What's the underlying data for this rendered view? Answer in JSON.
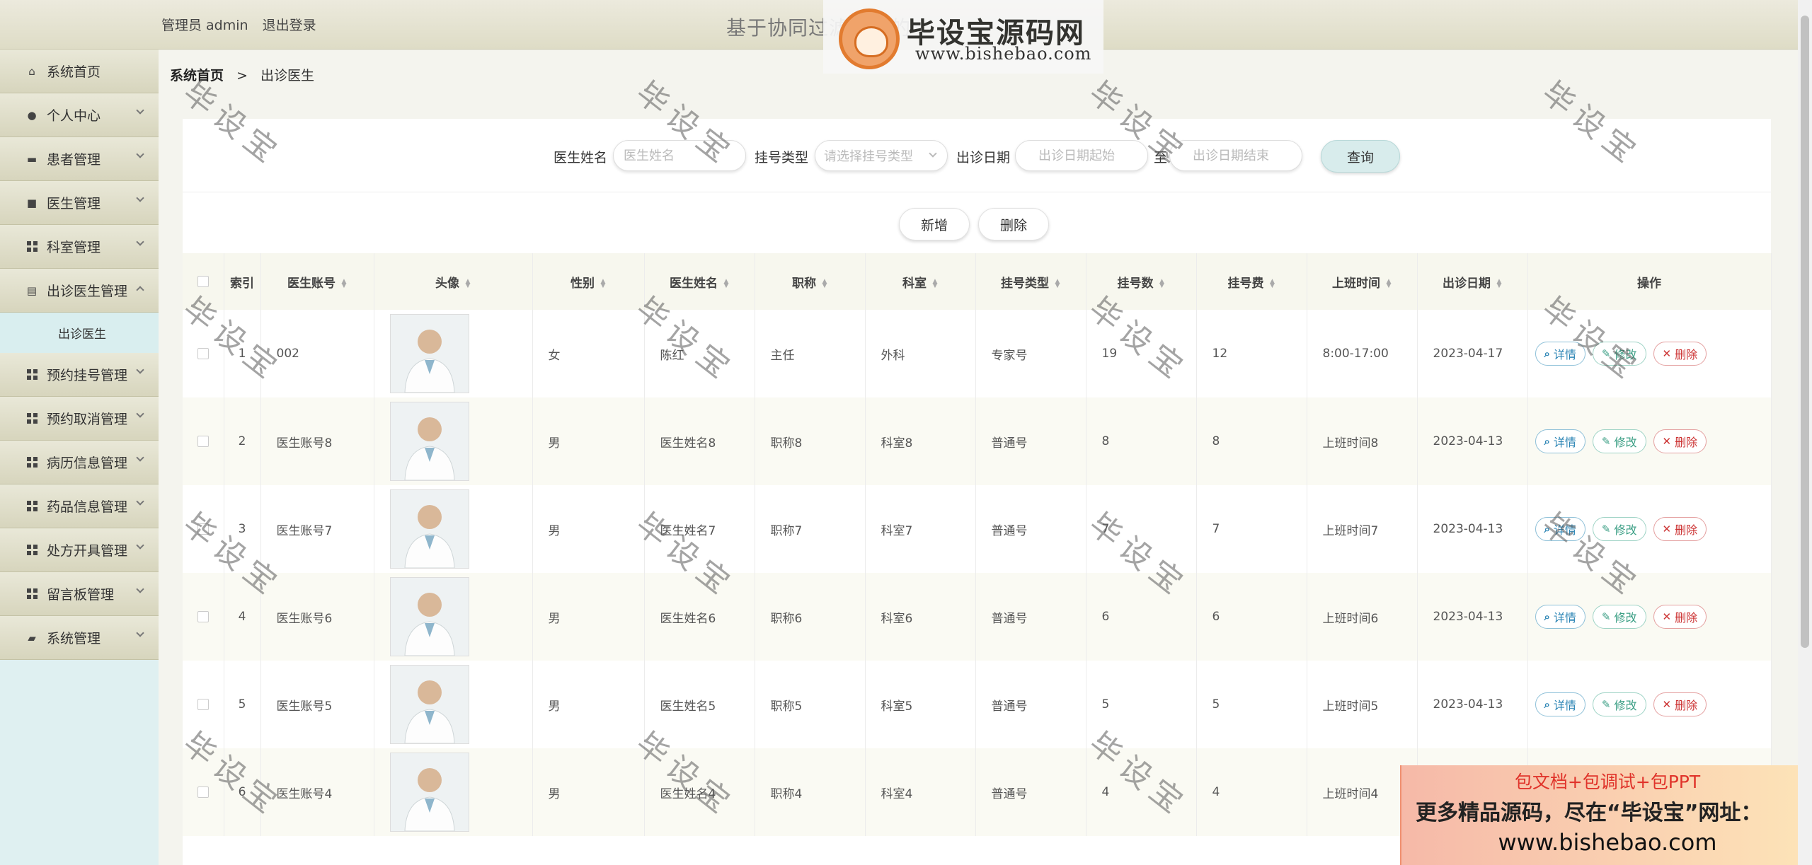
{
  "header": {
    "user_role": "管理员 admin",
    "logout": "退出登录",
    "system_title": "基于协同过滤算法的"
  },
  "logo": {
    "name": "毕设宝源码网",
    "url": "www.bishebao.com"
  },
  "sidebar": {
    "items": [
      {
        "label": "系统首页",
        "icon": "home-icon"
      },
      {
        "label": "个人中心",
        "icon": "user-icon"
      },
      {
        "label": "患者管理",
        "icon": "id-card-icon"
      },
      {
        "label": "医生管理",
        "icon": "doctor-icon"
      },
      {
        "label": "科室管理",
        "icon": "grid-icon"
      },
      {
        "label": "出诊医生管理",
        "icon": "clipboard-icon",
        "sub": [
          "出诊医生"
        ]
      },
      {
        "label": "预约挂号管理",
        "icon": "grid-icon"
      },
      {
        "label": "预约取消管理",
        "icon": "grid-icon"
      },
      {
        "label": "病历信息管理",
        "icon": "grid-icon"
      },
      {
        "label": "药品信息管理",
        "icon": "grid-icon"
      },
      {
        "label": "处方开具管理",
        "icon": "grid-icon"
      },
      {
        "label": "留言板管理",
        "icon": "grid-icon"
      },
      {
        "label": "系统管理",
        "icon": "briefcase-icon"
      }
    ]
  },
  "breadcrumb": {
    "home": "系统首页",
    "separator": ">",
    "current": "出诊医生"
  },
  "search": {
    "doctor_name_label": "医生姓名",
    "doctor_name_placeholder": "医生姓名",
    "reg_type_label": "挂号类型",
    "reg_type_placeholder": "请选择挂号类型",
    "date_label": "出诊日期",
    "date_start_placeholder": "出诊日期起始",
    "date_to": "至",
    "date_end_placeholder": "出诊日期结束",
    "query_button": "查询"
  },
  "actions": {
    "add": "新增",
    "delete": "删除"
  },
  "table": {
    "columns": [
      "索引",
      "医生账号",
      "头像",
      "性别",
      "医生姓名",
      "职称",
      "科室",
      "挂号类型",
      "挂号数",
      "挂号费",
      "上班时间",
      "出诊日期",
      "操作"
    ],
    "ops": {
      "detail": "详情",
      "edit": "修改",
      "delete": "删除"
    },
    "rows": [
      {
        "idx": "1",
        "account": "002",
        "gender": "女",
        "name": "陈红",
        "title": "主任",
        "dept": "外科",
        "type": "专家号",
        "count": "19",
        "fee": "12",
        "hours": "8:00-17:00",
        "date": "2023-04-17"
      },
      {
        "idx": "2",
        "account": "医生账号8",
        "gender": "男",
        "name": "医生姓名8",
        "title": "职称8",
        "dept": "科室8",
        "type": "普通号",
        "count": "8",
        "fee": "8",
        "hours": "上班时间8",
        "date": "2023-04-13"
      },
      {
        "idx": "3",
        "account": "医生账号7",
        "gender": "男",
        "name": "医生姓名7",
        "title": "职称7",
        "dept": "科室7",
        "type": "普通号",
        "count": "7",
        "fee": "7",
        "hours": "上班时间7",
        "date": "2023-04-13"
      },
      {
        "idx": "4",
        "account": "医生账号6",
        "gender": "男",
        "name": "医生姓名6",
        "title": "职称6",
        "dept": "科室6",
        "type": "普通号",
        "count": "6",
        "fee": "6",
        "hours": "上班时间6",
        "date": "2023-04-13"
      },
      {
        "idx": "5",
        "account": "医生账号5",
        "gender": "男",
        "name": "医生姓名5",
        "title": "职称5",
        "dept": "科室5",
        "type": "普通号",
        "count": "5",
        "fee": "5",
        "hours": "上班时间5",
        "date": "2023-04-13"
      },
      {
        "idx": "6",
        "account": "医生账号4",
        "gender": "男",
        "name": "医生姓名4",
        "title": "职称4",
        "dept": "科室4",
        "type": "普通号",
        "count": "4",
        "fee": "4",
        "hours": "上班时间4",
        "date": ""
      }
    ]
  },
  "watermark": "毕设宝",
  "promo": {
    "line1": "包文档+包调试+包PPT",
    "line2": "更多精品源码，尽在“毕设宝”网址：",
    "line3": "www.bishebao.com"
  },
  "colors": {
    "header_bg": "#e4e2cf",
    "sidebar_bg": "#dff0f1",
    "detail": "#2c85b5",
    "edit": "#3a9e84",
    "delete": "#cc3333"
  }
}
